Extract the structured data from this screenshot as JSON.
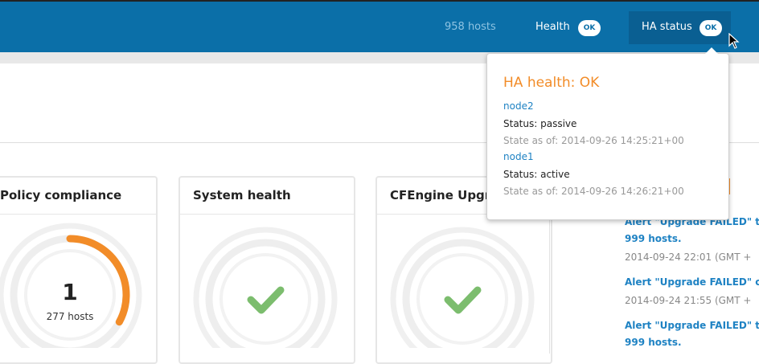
{
  "header": {
    "hosts_count": "958 hosts",
    "health_label": "Health",
    "health_badge": "OK",
    "ha_status_label": "HA status",
    "ha_status_badge": "OK"
  },
  "popover": {
    "title": "HA health: OK",
    "nodes": [
      {
        "name": "node2",
        "status": "Status: passive",
        "state_time": "State as of: 2014-09-26 14:25:21+00"
      },
      {
        "name": "node1",
        "status": "Status: active",
        "state_time": "State as of: 2014-09-26 14:26:21+00"
      }
    ]
  },
  "cards": [
    {
      "title": "Policy compliance",
      "value": "1",
      "subtitle": "277 hosts",
      "progress_fraction": 0.33
    },
    {
      "title": "System health",
      "icon": "check-icon"
    },
    {
      "title": "CFEngine Upgr",
      "icon": "check-icon"
    }
  ],
  "alerts": [
    {
      "line1": "Alert \"Upgrade FAILED\" tri",
      "line2": "999 hosts.",
      "time": "2014-09-24 22:01 (GMT +"
    },
    {
      "line1": "Alert \"Upgrade FAILED\" cl",
      "time": "2014-09-24 21:55 (GMT +"
    },
    {
      "line1": "Alert \"Upgrade FAILED\" tri",
      "line2": "999 hosts."
    }
  ],
  "colors": {
    "header_bg": "#0b6fa8",
    "accent_orange": "#f28c28",
    "link_blue": "#1e82c3",
    "check_green": "#7cbd6e"
  }
}
